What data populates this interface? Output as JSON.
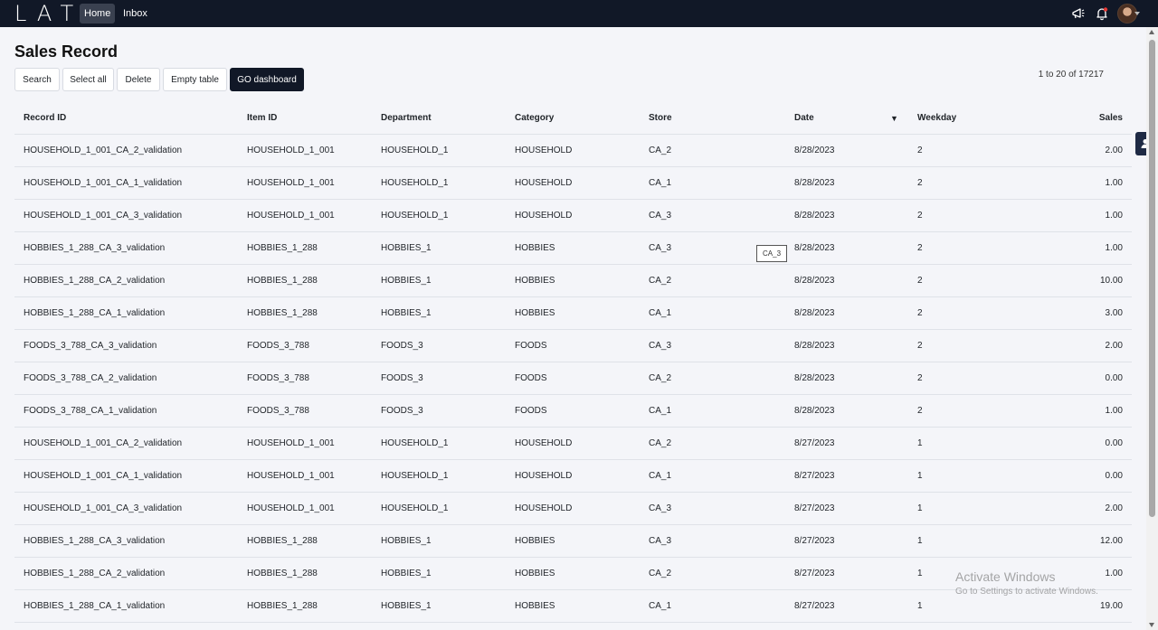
{
  "app": {
    "logo_text": "LATO",
    "nav": {
      "home_label": "Home",
      "inbox_label": "Inbox"
    },
    "icons": {
      "announce": "megaphone-icon",
      "notifications": "bell-icon",
      "avatar": "user-avatar"
    }
  },
  "page": {
    "title": "Sales Record",
    "toolbar": {
      "search_label": "Search",
      "select_all_label": "Select all",
      "delete_label": "Delete",
      "empty_table_label": "Empty table",
      "go_dashboard_label": "GO dashboard"
    },
    "pagination": "1 to 20 of 17217"
  },
  "table": {
    "columns": [
      "Record ID",
      "Item ID",
      "Department",
      "Category",
      "Store",
      "Date",
      "Weekday",
      "Sales"
    ],
    "sort_indicator": "▼",
    "rows": [
      [
        "HOUSEHOLD_1_001_CA_2_validation",
        "HOUSEHOLD_1_001",
        "HOUSEHOLD_1",
        "HOUSEHOLD",
        "CA_2",
        "8/28/2023",
        "2",
        "2.00"
      ],
      [
        "HOUSEHOLD_1_001_CA_1_validation",
        "HOUSEHOLD_1_001",
        "HOUSEHOLD_1",
        "HOUSEHOLD",
        "CA_1",
        "8/28/2023",
        "2",
        "1.00"
      ],
      [
        "HOUSEHOLD_1_001_CA_3_validation",
        "HOUSEHOLD_1_001",
        "HOUSEHOLD_1",
        "HOUSEHOLD",
        "CA_3",
        "8/28/2023",
        "2",
        "1.00"
      ],
      [
        "HOBBIES_1_288_CA_3_validation",
        "HOBBIES_1_288",
        "HOBBIES_1",
        "HOBBIES",
        "CA_3",
        "8/28/2023",
        "2",
        "1.00"
      ],
      [
        "HOBBIES_1_288_CA_2_validation",
        "HOBBIES_1_288",
        "HOBBIES_1",
        "HOBBIES",
        "CA_2",
        "8/28/2023",
        "2",
        "10.00"
      ],
      [
        "HOBBIES_1_288_CA_1_validation",
        "HOBBIES_1_288",
        "HOBBIES_1",
        "HOBBIES",
        "CA_1",
        "8/28/2023",
        "2",
        "3.00"
      ],
      [
        "FOODS_3_788_CA_3_validation",
        "FOODS_3_788",
        "FOODS_3",
        "FOODS",
        "CA_3",
        "8/28/2023",
        "2",
        "2.00"
      ],
      [
        "FOODS_3_788_CA_2_validation",
        "FOODS_3_788",
        "FOODS_3",
        "FOODS",
        "CA_2",
        "8/28/2023",
        "2",
        "0.00"
      ],
      [
        "FOODS_3_788_CA_1_validation",
        "FOODS_3_788",
        "FOODS_3",
        "FOODS",
        "CA_1",
        "8/28/2023",
        "2",
        "1.00"
      ],
      [
        "HOUSEHOLD_1_001_CA_2_validation",
        "HOUSEHOLD_1_001",
        "HOUSEHOLD_1",
        "HOUSEHOLD",
        "CA_2",
        "8/27/2023",
        "1",
        "0.00"
      ],
      [
        "HOUSEHOLD_1_001_CA_1_validation",
        "HOUSEHOLD_1_001",
        "HOUSEHOLD_1",
        "HOUSEHOLD",
        "CA_1",
        "8/27/2023",
        "1",
        "0.00"
      ],
      [
        "HOUSEHOLD_1_001_CA_3_validation",
        "HOUSEHOLD_1_001",
        "HOUSEHOLD_1",
        "HOUSEHOLD",
        "CA_3",
        "8/27/2023",
        "1",
        "2.00"
      ],
      [
        "HOBBIES_1_288_CA_3_validation",
        "HOBBIES_1_288",
        "HOBBIES_1",
        "HOBBIES",
        "CA_3",
        "8/27/2023",
        "1",
        "12.00"
      ],
      [
        "HOBBIES_1_288_CA_2_validation",
        "HOBBIES_1_288",
        "HOBBIES_1",
        "HOBBIES",
        "CA_2",
        "8/27/2023",
        "1",
        "1.00"
      ],
      [
        "HOBBIES_1_288_CA_1_validation",
        "HOBBIES_1_288",
        "HOBBIES_1",
        "HOBBIES",
        "CA_1",
        "8/27/2023",
        "1",
        "19.00"
      ]
    ]
  },
  "tooltip": {
    "text": "CA_3"
  },
  "watermark": {
    "title": "Activate Windows",
    "subtitle": "Go to Settings to activate Windows."
  }
}
